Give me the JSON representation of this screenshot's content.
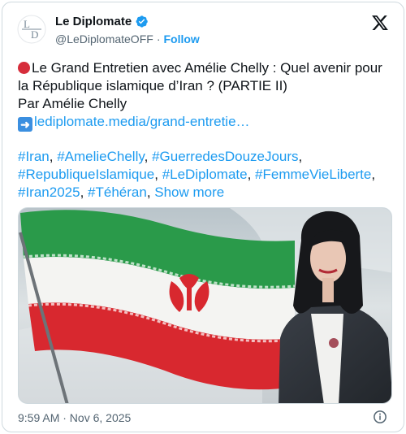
{
  "author": {
    "name": "Le Diplomate",
    "handle": "@LeDiplomateOFF",
    "separator": "·",
    "follow_label": "Follow",
    "logo_text": "LD"
  },
  "post": {
    "line1": "Le Grand Entretien avec Amélie Chelly : Quel avenir pour la République islamique d’Iran ? (PARTIE II)",
    "line2": "Par Amélie Chelly",
    "link_text": "lediplomate.media/grand-entretie…",
    "hashtags": [
      "#Iran",
      "#AmelieChelly",
      "#GuerredesDouzeJours",
      "#RepubliqueIslamique",
      "#LeDiplomate",
      "#FemmeVieLiberte",
      "#Iran2025",
      "#Téhéran"
    ],
    "show_more": "Show more"
  },
  "timestamp": "9:59 AM · Nov 6, 2025",
  "icons": {
    "verified": "verified-badge-icon",
    "x": "x-logo-icon",
    "info": "info-icon",
    "red_circle": "red-circle-emoji-icon",
    "arrow": "right-arrow-emoji-icon"
  },
  "colors": {
    "accent": "#1d9bf0",
    "text": "#0f1419",
    "muted": "#536471",
    "flag_green": "#2a9a4a",
    "flag_red": "#d8282f",
    "flag_white": "#f4f4f2"
  }
}
